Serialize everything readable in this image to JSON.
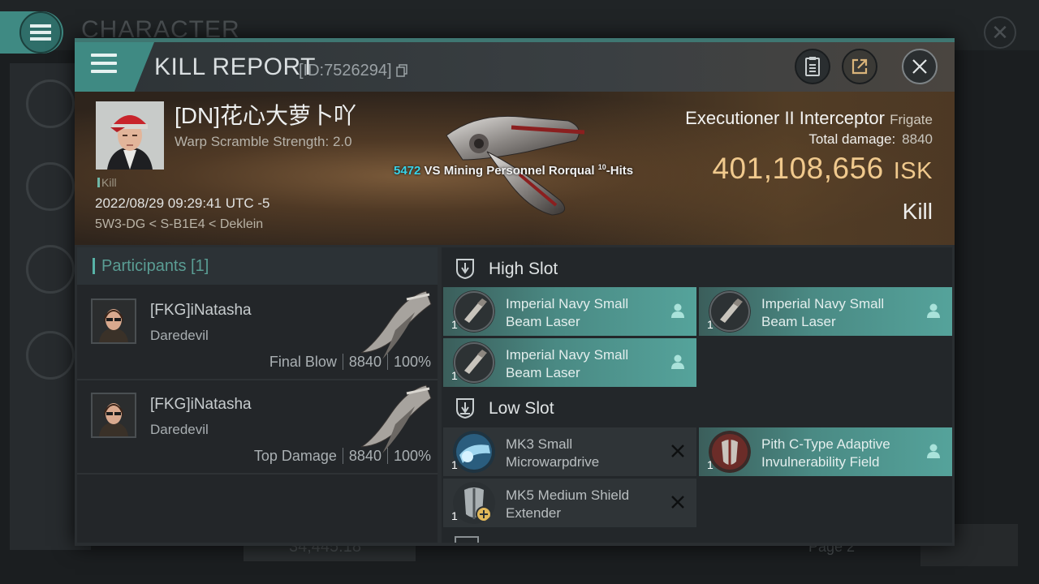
{
  "background": {
    "title": "CHARACTER",
    "bottom_value": "34,445.18",
    "page_label": "Page 2"
  },
  "dialog": {
    "title": "KILL REPORT",
    "id_label": "[ID:7526294]"
  },
  "victim": {
    "name": "[DN]花心大萝卜吖",
    "warp_scramble": "Warp Scramble Strength: 2.0",
    "tag": "Kill",
    "datetime": "2022/08/29 09:29:41 UTC -5",
    "location": "5W3-DG < S-B1E4 < Deklein",
    "vs_number": "5472",
    "vs_text": " VS Mining Personnel Rorqual ",
    "vs_superscript": "10",
    "vs_suffix": "-Hits"
  },
  "ship": {
    "name": "Executioner II Interceptor",
    "class": "Frigate",
    "total_damage_label": "Total damage:",
    "total_damage": "8840",
    "isk_value": "401,108,656",
    "isk_unit": "ISK",
    "result": "Kill"
  },
  "participants": {
    "header": "Participants [1]",
    "rows": [
      {
        "name": "[FKG]iNatasha",
        "ship": "Daredevil",
        "role": "Final Blow",
        "damage": "8840",
        "percent": "100%"
      },
      {
        "name": "[FKG]iNatasha",
        "ship": "Daredevil",
        "role": "Top Damage",
        "damage": "8840",
        "percent": "100%"
      }
    ]
  },
  "fitting": {
    "high_slot": {
      "title": "High Slot",
      "modules": [
        {
          "label": "Imperial Navy Small Beam Laser",
          "count": "1",
          "state": "active"
        },
        {
          "label": "Imperial Navy Small Beam Laser",
          "count": "1",
          "state": "active"
        },
        {
          "label": "Imperial Navy Small Beam Laser",
          "count": "1",
          "state": "active"
        }
      ]
    },
    "low_slot": {
      "title": "Low Slot",
      "modules": [
        {
          "label": "MK3 Small Microwarpdrive",
          "count": "1",
          "state": "destroyed"
        },
        {
          "label": "Pith C-Type Adaptive Invulnerability Field",
          "count": "1",
          "state": "active"
        },
        {
          "label": "MK5 Medium Shield Extender",
          "count": "1",
          "state": "destroyed"
        }
      ]
    }
  },
  "colors": {
    "accent_teal": "#3f8a83",
    "isk_gold": "#f0c98d",
    "vs_cyan": "#38d2e8"
  },
  "icons": [
    "menu-icon",
    "clipboard-icon",
    "share-icon",
    "close-icon",
    "pilot-icon",
    "x-mark-icon",
    "high-slot-icon",
    "low-slot-icon"
  ]
}
